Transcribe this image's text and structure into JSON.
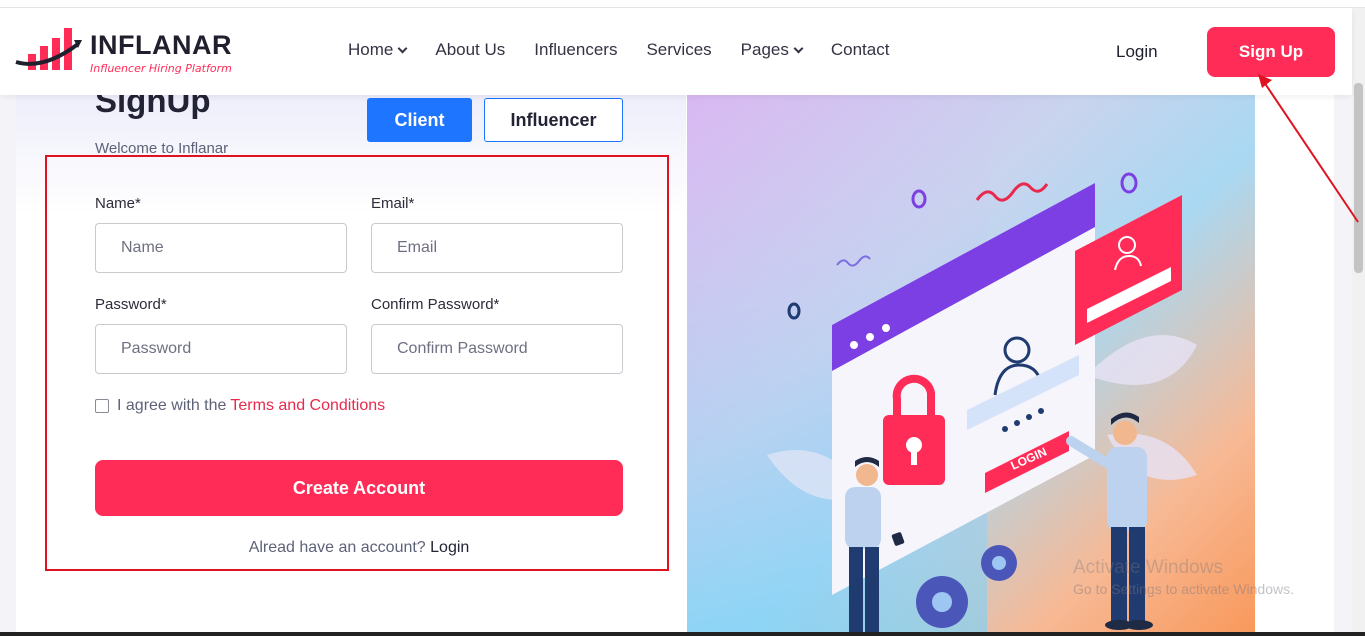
{
  "brand": {
    "name": "INFLANAR",
    "tagline": "Influencer Hiring Platform",
    "accent": "#ff2c57"
  },
  "nav": {
    "items": [
      {
        "label": "Home",
        "has_dropdown": true
      },
      {
        "label": "About Us",
        "has_dropdown": false
      },
      {
        "label": "Influencers",
        "has_dropdown": false
      },
      {
        "label": "Services",
        "has_dropdown": false
      },
      {
        "label": "Pages",
        "has_dropdown": true
      },
      {
        "label": "Contact",
        "has_dropdown": false
      }
    ],
    "login": "Login",
    "signup": "Sign Up"
  },
  "form": {
    "title": "SignUp",
    "welcome": "Welcome to Inflanar",
    "role_client": "Client",
    "role_influencer": "Influencer",
    "name_label": "Name*",
    "name_placeholder": "Name",
    "email_label": "Email*",
    "email_placeholder": "Email",
    "password_label": "Password*",
    "password_placeholder": "Password",
    "confirm_label": "Confirm Password*",
    "confirm_placeholder": "Confirm Password",
    "agree_text": "I agree with the",
    "terms_link": "Terms and Conditions",
    "create_button": "Create Account",
    "already_text": "Alread have an account?",
    "already_login": "Login"
  },
  "illustration": {
    "login_badge": "LOGIN"
  },
  "watermark": {
    "line1": "Activate Windows",
    "line2": "Go to Settings to activate Windows."
  },
  "colors": {
    "primary_blue": "#1e75ff",
    "annotation_red": "#e0121f"
  }
}
